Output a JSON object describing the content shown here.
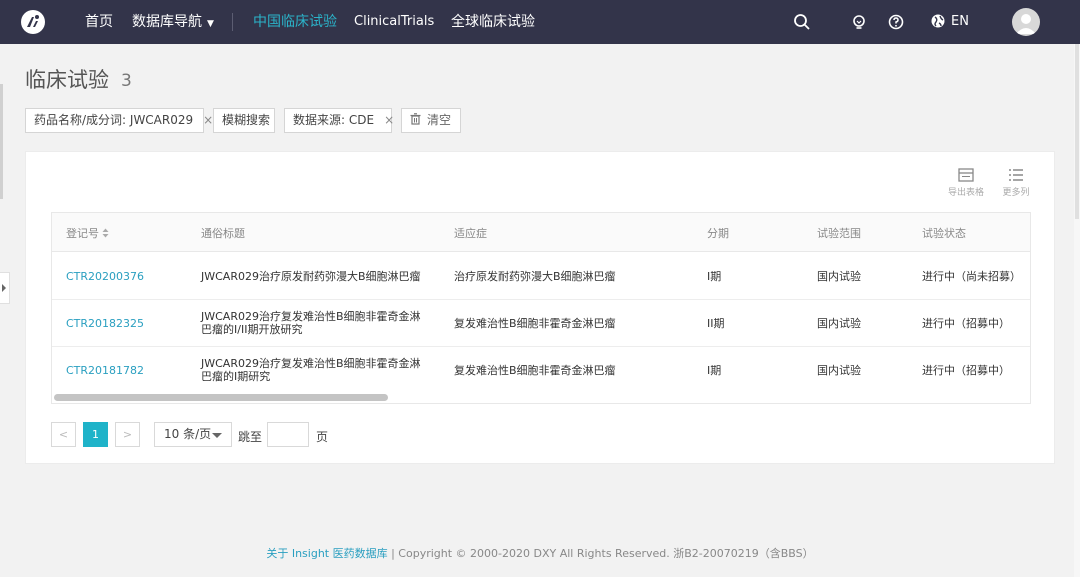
{
  "nav": {
    "home": "首页",
    "database_nav": "数据库导航",
    "china_trials": "中国临床试验",
    "clinicaltrials": "ClinicalTrials",
    "global_trials": "全球临床试验",
    "lang": "EN"
  },
  "page": {
    "title": "临床试验",
    "count": "3"
  },
  "filters": {
    "drug": "药品名称/成分词: JWCAR029",
    "fuzzy": "模糊搜索",
    "source": "数据来源: CDE",
    "clear": "清空"
  },
  "tools": {
    "export": "导出表格",
    "more_columns": "更多列"
  },
  "table": {
    "headers": [
      "登记号",
      "通俗标题",
      "适应症",
      "分期",
      "试验范围",
      "试验状态"
    ],
    "rows": [
      {
        "id": "CTR20200376",
        "title_1": "JWCAR029治疗原发耐药弥漫大B细胞淋巴瘤",
        "title_2": "",
        "indication": "治疗原发耐药弥漫大B细胞淋巴瘤",
        "phase": "I期",
        "scope": "国内试验",
        "status": "进行中（尚未招募）"
      },
      {
        "id": "CTR20182325",
        "title_1": "JWCAR029治疗复发难治性B细胞非霍奇金淋",
        "title_2": "巴瘤的I/II期开放研究",
        "indication": "复发难治性B细胞非霍奇金淋巴瘤",
        "phase": "II期",
        "scope": "国内试验",
        "status": "进行中（招募中）"
      },
      {
        "id": "CTR20181782",
        "title_1": "JWCAR029治疗复发难治性B细胞非霍奇金淋",
        "title_2": "巴瘤的I期研究",
        "indication": "复发难治性B细胞非霍奇金淋巴瘤",
        "phase": "I期",
        "scope": "国内试验",
        "status": "进行中（招募中）"
      }
    ]
  },
  "pagination": {
    "prev": "<",
    "current": "1",
    "next": ">",
    "page_size": "10 条/页",
    "jump_label": "跳至",
    "page_unit": "页"
  },
  "footer": {
    "about_link": "关于 Insight 医药数据库",
    "copyright": " | Copyright © 2000-2020 DXY All Rights Reserved. 浙B2-20070219（含BBS）"
  }
}
